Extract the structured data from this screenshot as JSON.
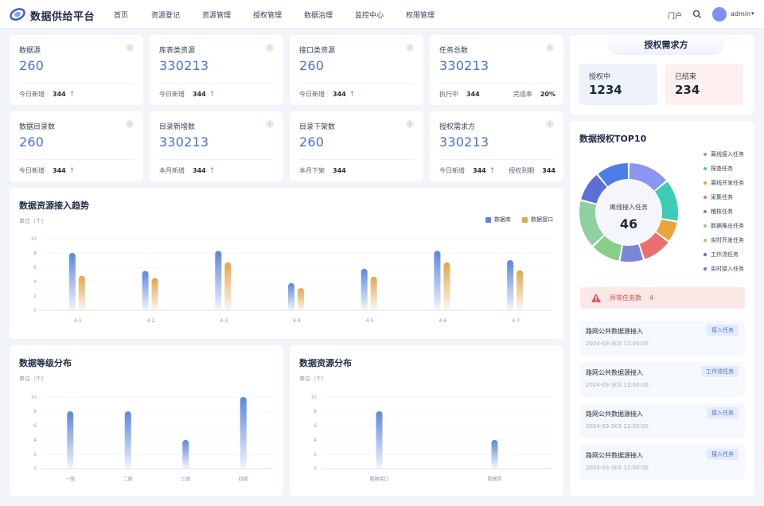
{
  "app": {
    "title": "数据供给平台",
    "portal": "门户",
    "user": "admin"
  },
  "nav": [
    "首页",
    "资源登记",
    "资源管理",
    "授权管理",
    "数据治理",
    "监控中心",
    "权限管理"
  ],
  "stats": [
    {
      "title": "数据源",
      "value": "260",
      "foot_label": "今日新增",
      "foot_value": "344",
      "trend": "up"
    },
    {
      "title": "库表类资源",
      "value": "330213",
      "foot_label": "今日新增",
      "foot_value": "344",
      "trend": "up"
    },
    {
      "title": "接口类资源",
      "value": "260",
      "foot_label": "今日新增",
      "foot_value": "344",
      "trend": "up"
    },
    {
      "title": "任务总数",
      "value": "330213",
      "foot_label": "执行中",
      "foot_value": "344",
      "right_label": "完成率",
      "right_value": "20%"
    },
    {
      "title": "数据目录数",
      "value": "260",
      "foot_label": "今日新增",
      "foot_value": "344",
      "trend": "up"
    },
    {
      "title": "目录新增数",
      "value": "330213",
      "foot_label": "本月新增",
      "foot_value": "344",
      "trend": "up"
    },
    {
      "title": "目录下架数",
      "value": "260",
      "foot_label": "本月下架",
      "foot_value": "344"
    },
    {
      "title": "授权需求方",
      "value": "330213",
      "foot_label": "今日新增",
      "foot_value": "344",
      "trend": "up",
      "right_label": "授权到期",
      "right_value": "344"
    }
  ],
  "trend_section": {
    "title": "数据资源接入趋势",
    "unit": "单位（个）"
  },
  "level_section": {
    "title": "数据等级分布",
    "unit": "单位（个）"
  },
  "resource_section": {
    "title": "数据资源分布",
    "unit": "单位（个）"
  },
  "chart_data": [
    {
      "type": "bar",
      "title": "数据资源接入趋势",
      "categories": [
        "4-1",
        "4-2",
        "4-3",
        "4-4",
        "4-5",
        "4-6",
        "4-7"
      ],
      "series": [
        {
          "name": "数据库",
          "values": [
            8,
            5.5,
            8.3,
            3.8,
            5.8,
            8.3,
            7
          ],
          "color": "#5b86de"
        },
        {
          "name": "数据接口",
          "values": [
            4.8,
            4.5,
            6.7,
            3.1,
            4.7,
            6.7,
            5.6
          ],
          "color": "#e3a54a"
        }
      ],
      "ylim": [
        0,
        10
      ],
      "yticks": [
        0,
        2,
        4,
        6,
        8,
        10
      ],
      "legend": "top-right"
    },
    {
      "type": "bar",
      "title": "数据等级分布",
      "categories": [
        "一级",
        "二级",
        "三级",
        "四级"
      ],
      "values": [
        8,
        8,
        4,
        10
      ],
      "ylim": [
        0,
        10
      ],
      "yticks": [
        0,
        2,
        4,
        6,
        8,
        10
      ]
    },
    {
      "type": "bar",
      "title": "数据资源分布",
      "categories": [
        "数据接口",
        "数据库"
      ],
      "values": [
        8,
        4
      ],
      "ylim": [
        0,
        10
      ],
      "yticks": [
        0,
        2,
        4,
        6,
        8,
        10
      ]
    },
    {
      "type": "pie",
      "title": "数据授权TOP10",
      "center_label": "离线接入任务",
      "center_value": "46",
      "categories": [
        "离线接入任务",
        "探查任务",
        "离线开发任务",
        "采集任务",
        "稽核任务",
        "数据推出任务",
        "实时开发任务",
        "工作流任务",
        "实时接入任务"
      ],
      "values": [
        14,
        14,
        7,
        10,
        8,
        10,
        16,
        10,
        11
      ],
      "colors": [
        "#8a96f2",
        "#3ccbb7",
        "#eba33c",
        "#ec6f6f",
        "#7b85d9",
        "#86cf86",
        "#8fd0a0",
        "#5b6fd6",
        "#4c7fe6"
      ],
      "legend": "right"
    }
  ],
  "auth_demand": {
    "title": "授权需求方",
    "items": [
      {
        "label": "授权中",
        "value": "1234"
      },
      {
        "label": "已结束",
        "value": "234"
      }
    ]
  },
  "top10": {
    "title": "数据授权TOP10"
  },
  "alert": {
    "label": "异常任务数",
    "value": "4"
  },
  "tasks": [
    {
      "title": "路网公共数据源接入",
      "time": "2024-03-303 12:00:00",
      "tag": "接入任务"
    },
    {
      "title": "路网公共数据源接入",
      "time": "2024-03-303 12:00:00",
      "tag": "工作流任务"
    },
    {
      "title": "路网公共数据源接入",
      "time": "2024-03-303 12:00:00",
      "tag": "接入任务"
    },
    {
      "title": "路网公共数据源接入",
      "time": "2024-03-303 12:00:00",
      "tag": "接入任务"
    }
  ]
}
